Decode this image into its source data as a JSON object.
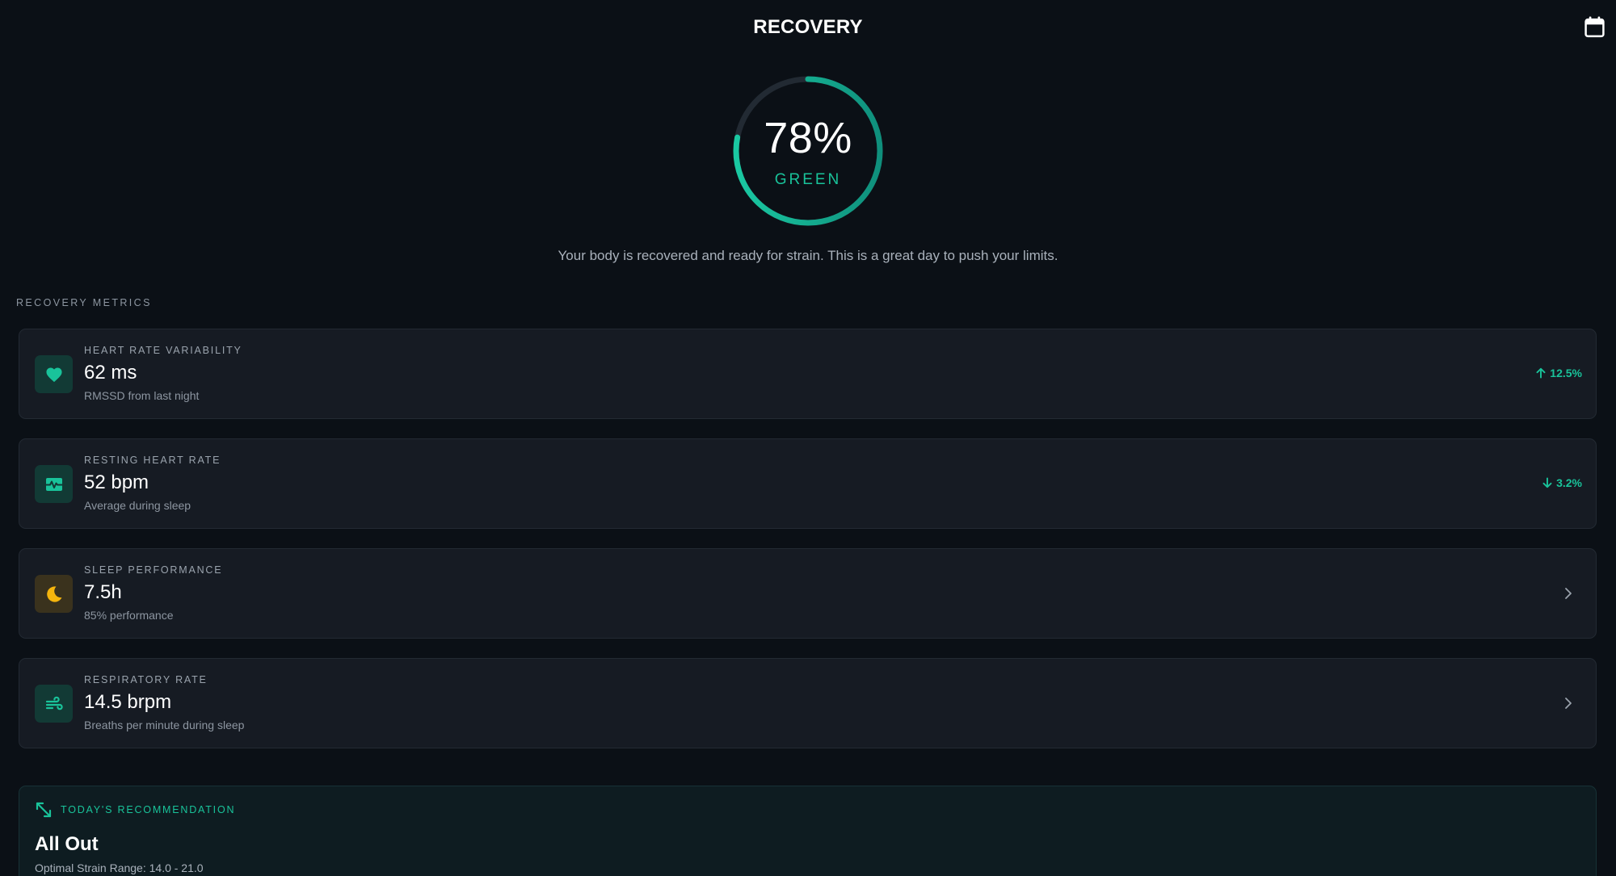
{
  "header": {
    "title": "RECOVERY",
    "calendar_icon": "calendar-icon"
  },
  "recovery": {
    "score_text": "78%",
    "score": 78,
    "status": "GREEN",
    "message": "Your body is recovered and ready for strain. This is a great day to push your limits."
  },
  "colors": {
    "accent": "#19c39a",
    "accent_dark": "#0f8f7c",
    "track": "#222a33",
    "amber": "#f5b50d",
    "background": "#0b1016",
    "card": "#161b23"
  },
  "metrics_section": {
    "label": "RECOVERY METRICS",
    "items": [
      {
        "icon": "heart-icon",
        "label": "HEART RATE VARIABILITY",
        "value": "62 ms",
        "sub": "RMSSD from last night",
        "trend": "12.5%",
        "trend_direction": "up"
      },
      {
        "icon": "heart-pulse-icon",
        "label": "RESTING HEART RATE",
        "value": "52 bpm",
        "sub": "Average during sleep",
        "trend": "3.2%",
        "trend_direction": "down"
      },
      {
        "icon": "moon-icon",
        "label": "SLEEP PERFORMANCE",
        "value": "7.5h",
        "sub": "85% performance"
      },
      {
        "icon": "wind-icon",
        "label": "RESPIRATORY RATE",
        "value": "14.5 brpm",
        "sub": "Breaths per minute during sleep"
      }
    ]
  },
  "recommendation": {
    "icon": "expand-arrows-icon",
    "label": "TODAY'S RECOMMENDATION",
    "title": "All Out",
    "range": "Optimal Strain Range: 14.0 - 21.0"
  }
}
